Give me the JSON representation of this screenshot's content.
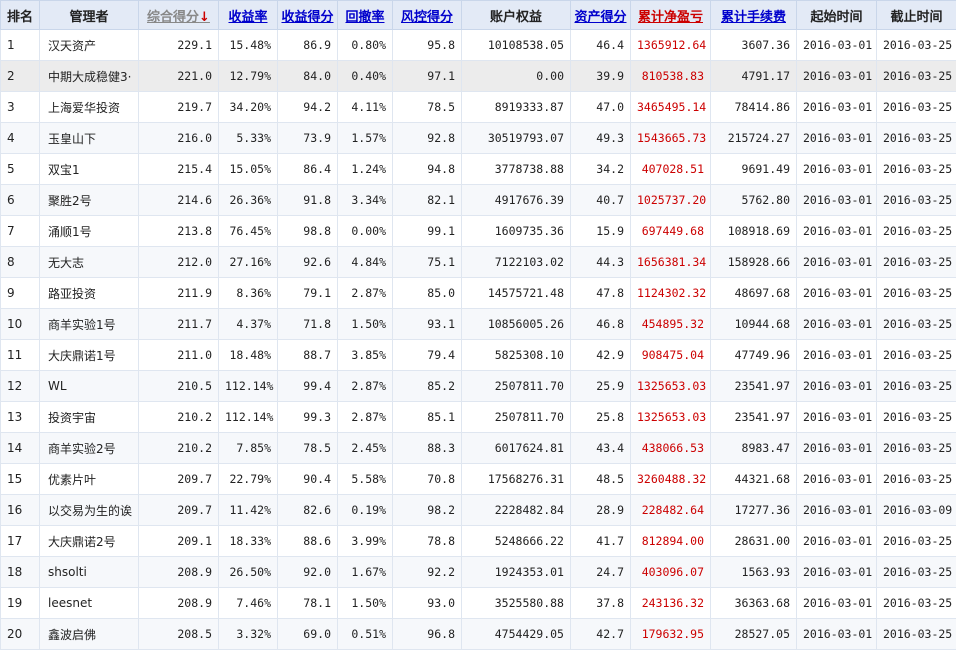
{
  "headers": {
    "rank": "排名",
    "manager": "管理者",
    "composite": "综合得分",
    "return_rate": "收益率",
    "return_score": "收益得分",
    "drawdown": "回撤率",
    "risk_score": "风控得分",
    "equity": "账户权益",
    "asset_score": "资产得分",
    "pnl": "累计净盈亏",
    "fee": "累计手续费",
    "start": "起始时间",
    "end": "截止时间"
  },
  "sort_arrow": "↓",
  "rows": [
    {
      "rank": "1",
      "manager": "汉天资产",
      "composite": "229.1",
      "return_rate": "15.48%",
      "return_score": "86.9",
      "drawdown": "0.80%",
      "risk_score": "95.8",
      "equity": "10108538.05",
      "asset_score": "46.4",
      "pnl": "1365912.64",
      "fee": "3607.36",
      "start": "2016-03-01",
      "end": "2016-03-25"
    },
    {
      "rank": "2",
      "manager": "中期大成稳健3·",
      "composite": "221.0",
      "return_rate": "12.79%",
      "return_score": "84.0",
      "drawdown": "0.40%",
      "risk_score": "97.1",
      "equity": "0.00",
      "asset_score": "39.9",
      "pnl": "810538.83",
      "fee": "4791.17",
      "start": "2016-03-01",
      "end": "2016-03-25"
    },
    {
      "rank": "3",
      "manager": "上海爱华投资",
      "composite": "219.7",
      "return_rate": "34.20%",
      "return_score": "94.2",
      "drawdown": "4.11%",
      "risk_score": "78.5",
      "equity": "8919333.87",
      "asset_score": "47.0",
      "pnl": "3465495.14",
      "fee": "78414.86",
      "start": "2016-03-01",
      "end": "2016-03-25"
    },
    {
      "rank": "4",
      "manager": "玉皇山下",
      "composite": "216.0",
      "return_rate": "5.33%",
      "return_score": "73.9",
      "drawdown": "1.57%",
      "risk_score": "92.8",
      "equity": "30519793.07",
      "asset_score": "49.3",
      "pnl": "1543665.73",
      "fee": "215724.27",
      "start": "2016-03-01",
      "end": "2016-03-25"
    },
    {
      "rank": "5",
      "manager": "双宝1",
      "composite": "215.4",
      "return_rate": "15.05%",
      "return_score": "86.4",
      "drawdown": "1.24%",
      "risk_score": "94.8",
      "equity": "3778738.88",
      "asset_score": "34.2",
      "pnl": "407028.51",
      "fee": "9691.49",
      "start": "2016-03-01",
      "end": "2016-03-25"
    },
    {
      "rank": "6",
      "manager": "聚胜2号",
      "composite": "214.6",
      "return_rate": "26.36%",
      "return_score": "91.8",
      "drawdown": "3.34%",
      "risk_score": "82.1",
      "equity": "4917676.39",
      "asset_score": "40.7",
      "pnl": "1025737.20",
      "fee": "5762.80",
      "start": "2016-03-01",
      "end": "2016-03-25"
    },
    {
      "rank": "7",
      "manager": "涌顺1号",
      "composite": "213.8",
      "return_rate": "76.45%",
      "return_score": "98.8",
      "drawdown": "0.00%",
      "risk_score": "99.1",
      "equity": "1609735.36",
      "asset_score": "15.9",
      "pnl": "697449.68",
      "fee": "108918.69",
      "start": "2016-03-01",
      "end": "2016-03-25"
    },
    {
      "rank": "8",
      "manager": "无大志",
      "composite": "212.0",
      "return_rate": "27.16%",
      "return_score": "92.6",
      "drawdown": "4.84%",
      "risk_score": "75.1",
      "equity": "7122103.02",
      "asset_score": "44.3",
      "pnl": "1656381.34",
      "fee": "158928.66",
      "start": "2016-03-01",
      "end": "2016-03-25"
    },
    {
      "rank": "9",
      "manager": "路亚投资",
      "composite": "211.9",
      "return_rate": "8.36%",
      "return_score": "79.1",
      "drawdown": "2.87%",
      "risk_score": "85.0",
      "equity": "14575721.48",
      "asset_score": "47.8",
      "pnl": "1124302.32",
      "fee": "48697.68",
      "start": "2016-03-01",
      "end": "2016-03-25"
    },
    {
      "rank": "10",
      "manager": "商羊实验1号",
      "composite": "211.7",
      "return_rate": "4.37%",
      "return_score": "71.8",
      "drawdown": "1.50%",
      "risk_score": "93.1",
      "equity": "10856005.26",
      "asset_score": "46.8",
      "pnl": "454895.32",
      "fee": "10944.68",
      "start": "2016-03-01",
      "end": "2016-03-25"
    },
    {
      "rank": "11",
      "manager": "大庆鼎诺1号",
      "composite": "211.0",
      "return_rate": "18.48%",
      "return_score": "88.7",
      "drawdown": "3.85%",
      "risk_score": "79.4",
      "equity": "5825308.10",
      "asset_score": "42.9",
      "pnl": "908475.04",
      "fee": "47749.96",
      "start": "2016-03-01",
      "end": "2016-03-25"
    },
    {
      "rank": "12",
      "manager": "WL",
      "composite": "210.5",
      "return_rate": "112.14%",
      "return_score": "99.4",
      "drawdown": "2.87%",
      "risk_score": "85.2",
      "equity": "2507811.70",
      "asset_score": "25.9",
      "pnl": "1325653.03",
      "fee": "23541.97",
      "start": "2016-03-01",
      "end": "2016-03-25"
    },
    {
      "rank": "13",
      "manager": "投资宇宙",
      "composite": "210.2",
      "return_rate": "112.14%",
      "return_score": "99.3",
      "drawdown": "2.87%",
      "risk_score": "85.1",
      "equity": "2507811.70",
      "asset_score": "25.8",
      "pnl": "1325653.03",
      "fee": "23541.97",
      "start": "2016-03-01",
      "end": "2016-03-25"
    },
    {
      "rank": "14",
      "manager": "商羊实验2号",
      "composite": "210.2",
      "return_rate": "7.85%",
      "return_score": "78.5",
      "drawdown": "2.45%",
      "risk_score": "88.3",
      "equity": "6017624.81",
      "asset_score": "43.4",
      "pnl": "438066.53",
      "fee": "8983.47",
      "start": "2016-03-01",
      "end": "2016-03-25"
    },
    {
      "rank": "15",
      "manager": "优素片叶",
      "composite": "209.7",
      "return_rate": "22.79%",
      "return_score": "90.4",
      "drawdown": "5.58%",
      "risk_score": "70.8",
      "equity": "17568276.31",
      "asset_score": "48.5",
      "pnl": "3260488.32",
      "fee": "44321.68",
      "start": "2016-03-01",
      "end": "2016-03-25"
    },
    {
      "rank": "16",
      "manager": "以交易为生的诶",
      "composite": "209.7",
      "return_rate": "11.42%",
      "return_score": "82.6",
      "drawdown": "0.19%",
      "risk_score": "98.2",
      "equity": "2228482.84",
      "asset_score": "28.9",
      "pnl": "228482.64",
      "fee": "17277.36",
      "start": "2016-03-01",
      "end": "2016-03-09"
    },
    {
      "rank": "17",
      "manager": "大庆鼎诺2号",
      "composite": "209.1",
      "return_rate": "18.33%",
      "return_score": "88.6",
      "drawdown": "3.99%",
      "risk_score": "78.8",
      "equity": "5248666.22",
      "asset_score": "41.7",
      "pnl": "812894.00",
      "fee": "28631.00",
      "start": "2016-03-01",
      "end": "2016-03-25"
    },
    {
      "rank": "18",
      "manager": "shsolti",
      "composite": "208.9",
      "return_rate": "26.50%",
      "return_score": "92.0",
      "drawdown": "1.67%",
      "risk_score": "92.2",
      "equity": "1924353.01",
      "asset_score": "24.7",
      "pnl": "403096.07",
      "fee": "1563.93",
      "start": "2016-03-01",
      "end": "2016-03-25"
    },
    {
      "rank": "19",
      "manager": "leesnet",
      "composite": "208.9",
      "return_rate": "7.46%",
      "return_score": "78.1",
      "drawdown": "1.50%",
      "risk_score": "93.0",
      "equity": "3525580.88",
      "asset_score": "37.8",
      "pnl": "243136.32",
      "fee": "36363.68",
      "start": "2016-03-01",
      "end": "2016-03-25"
    },
    {
      "rank": "20",
      "manager": "鑫波启佛",
      "composite": "208.5",
      "return_rate": "3.32%",
      "return_score": "69.0",
      "drawdown": "0.51%",
      "risk_score": "96.8",
      "equity": "4754429.05",
      "asset_score": "42.7",
      "pnl": "179632.95",
      "fee": "28527.05",
      "start": "2016-03-01",
      "end": "2016-03-25"
    }
  ],
  "colors": {
    "header_bg": "#e3eaf6",
    "link": "#0000cc",
    "negative": "#cc0000",
    "highlight_row": "#ececec"
  }
}
